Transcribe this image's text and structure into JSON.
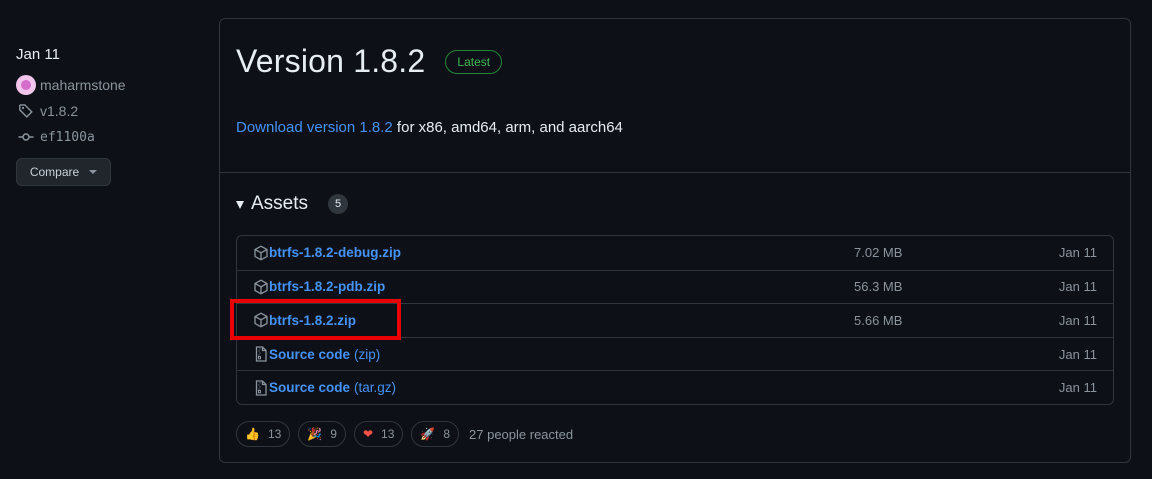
{
  "meta": {
    "date": "Jan 11",
    "author": "maharmstone",
    "tag": "v1.8.2",
    "commit": "ef1100a",
    "compare_label": "Compare"
  },
  "release": {
    "title": "Version 1.8.2",
    "badge": "Latest",
    "download_link": "Download version 1.8.2",
    "download_suffix": " for x86, amd64, arm, and aarch64",
    "assets_title": "Assets",
    "assets_count": "5",
    "assets": [
      {
        "name": "btrfs-1.8.2-debug.zip",
        "sub": "",
        "size": "7.02 MB",
        "date": "Jan 11",
        "icon": "package-icon"
      },
      {
        "name": "btrfs-1.8.2-pdb.zip",
        "sub": "",
        "size": "56.3 MB",
        "date": "Jan 11",
        "icon": "package-icon"
      },
      {
        "name": "btrfs-1.8.2.zip",
        "sub": "",
        "size": "5.66 MB",
        "date": "Jan 11",
        "icon": "package-icon"
      },
      {
        "name": "Source code",
        "sub": "(zip)",
        "size": "",
        "date": "Jan 11",
        "icon": "file-zip-icon"
      },
      {
        "name": "Source code",
        "sub": "(tar.gz)",
        "size": "",
        "date": "Jan 11",
        "icon": "file-zip-icon"
      }
    ],
    "reactions": [
      {
        "emoji": "👍",
        "count": "13",
        "icon": "thumbs-up-icon"
      },
      {
        "emoji": "🎉",
        "count": "9",
        "icon": "tada-icon"
      },
      {
        "emoji": "❤",
        "count": "13",
        "icon": "heart-icon"
      },
      {
        "emoji": "🚀",
        "count": "8",
        "icon": "rocket-icon"
      }
    ],
    "reacted_text": "27 people reacted"
  },
  "colors": {
    "background": "#0d1117",
    "link": "#4493f8",
    "muted": "#8b949e",
    "border": "#30363d",
    "latest_green": "#3fb950",
    "highlight_red": "#e80000"
  }
}
